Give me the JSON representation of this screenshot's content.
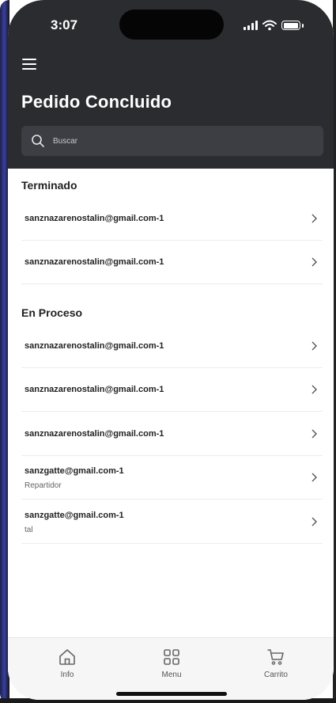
{
  "status_bar": {
    "time": "3:07"
  },
  "header": {
    "title": "Pedido Concluido",
    "search": {
      "placeholder": "Buscar",
      "value": ""
    }
  },
  "sections": [
    {
      "title": "Terminado",
      "items": [
        {
          "email": "sanznazarenostalin@gmail.com-1",
          "subtitle": ""
        },
        {
          "email": "sanznazarenostalin@gmail.com-1",
          "subtitle": ""
        }
      ]
    },
    {
      "title": "En Proceso",
      "items": [
        {
          "email": "sanznazarenostalin@gmail.com-1",
          "subtitle": ""
        },
        {
          "email": "sanznazarenostalin@gmail.com-1",
          "subtitle": ""
        },
        {
          "email": "sanznazarenostalin@gmail.com-1",
          "subtitle": ""
        },
        {
          "email": "sanzgatte@gmail.com-1",
          "subtitle": "Repartidor"
        },
        {
          "email": "sanzgatte@gmail.com-1",
          "subtitle": "tal"
        }
      ]
    }
  ],
  "tabbar": {
    "tabs": [
      {
        "label": "Info",
        "icon": "home-icon"
      },
      {
        "label": "Menu",
        "icon": "grid-icon"
      },
      {
        "label": "Carrito",
        "icon": "cart-icon"
      }
    ]
  },
  "colors": {
    "header_bg": "#2a2c30",
    "search_bg": "#3c3e43",
    "tabbar_bg": "#f6f6f6"
  }
}
